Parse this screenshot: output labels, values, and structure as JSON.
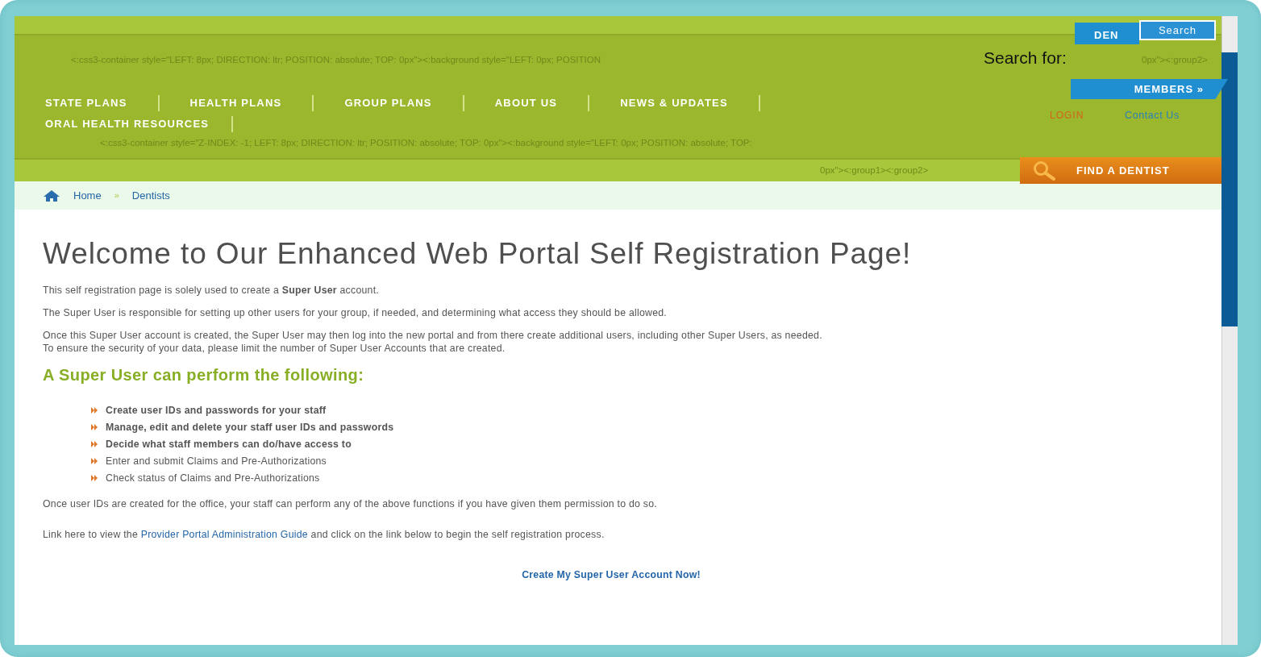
{
  "header": {
    "code_line_1": "<:css3-container style=\"LEFT: 8px; DIRECTION: ltr; POSITION: absolute; TOP: 0px\"><:background style=\"LEFT: 0px; POSITION",
    "code_line_1_end": "0px\"><:group2>",
    "code_line_2": "<:css3-container style=\"Z-INDEX: -1; LEFT: 8px; DIRECTION: ltr; POSITION: absolute; TOP: 0px\"><:background style=\"LEFT: 0px; POSITION: absolute; TOP:",
    "code_line_3": "0px\"><:group1><:group2>",
    "nav": [
      {
        "label": "STATE PLANS"
      },
      {
        "label": "HEALTH PLANS"
      },
      {
        "label": "GROUP PLANS"
      },
      {
        "label": "ABOUT US"
      },
      {
        "label": "NEWS & UPDATES"
      },
      {
        "label": "ORAL HEALTH RESOURCES"
      }
    ],
    "dentists_tab": "DEN",
    "search_button": "Search",
    "search_label": "Search for:",
    "members_button": "MEMBERS »",
    "login_link": "LOGIN",
    "contact_link": "Contact Us",
    "find_button": "FIND A DENTIST"
  },
  "breadcrumb": [
    "Home",
    "Dentists"
  ],
  "breadcrumb_separator": "»",
  "title": "Welcome to Our Enhanced Web Portal Self Registration Page!",
  "paragraphs": [
    "This self registration page is solely used to create a **Super User** account.",
    "The Super User is responsible for setting up other users for your group, if needed, and determining what access they should be allowed.",
    "Once this Super User account is created, the Super User may then log into the new portal and from there create additional users, including other Super Users, as needed.\nTo ensure the security of your data, please limit the number of Super User Accounts that are created."
  ],
  "subheading": "A Super User can perform the following:",
  "abilities": [
    {
      "text": "Create user IDs and passwords for your staff",
      "bold": true
    },
    {
      "text": "Manage, edit and delete your staff user IDs and passwords",
      "bold": true
    },
    {
      "text": "Decide what staff members can do/have access to",
      "bold": true
    },
    {
      "text": "Enter and submit Claims and Pre-Authorizations",
      "bold": false
    },
    {
      "text": "Check status of Claims and Pre-Authorizations",
      "bold": false
    }
  ],
  "after_list": "Once user IDs are created for the office, your staff can perform any of the above functions if you have given them permission to do so.",
  "guide_paragraph": {
    "before": "Link here to view the ",
    "link": "Provider Portal Administration Guide",
    "after": " and click on the link below to begin the self registration process."
  },
  "create_link": "Create My Super User Account Now!"
}
